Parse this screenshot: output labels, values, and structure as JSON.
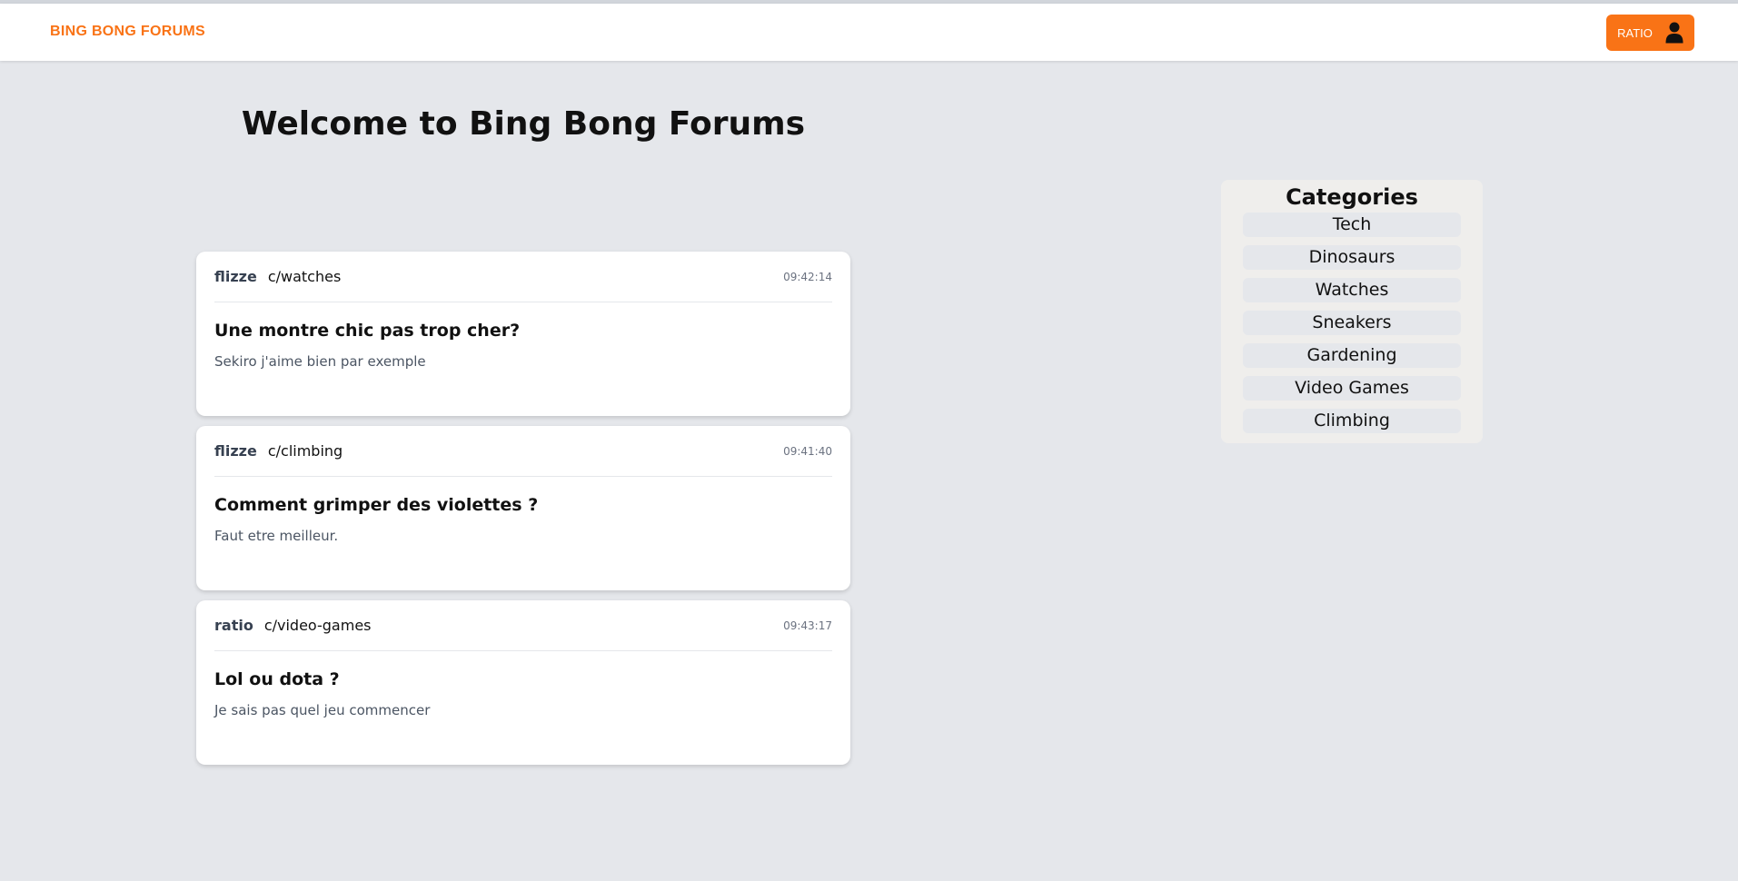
{
  "header": {
    "brand": "BING BONG FORUMS",
    "user_button_label": "RATIO",
    "user_icon": "user-icon"
  },
  "main": {
    "title": "Welcome to Bing Bong Forums",
    "posts": [
      {
        "author": "flizze",
        "category": "c/watches",
        "time": "09:42:14",
        "title": "Une montre chic pas trop cher?",
        "body": "Sekiro j'aime bien par exemple"
      },
      {
        "author": "flizze",
        "category": "c/climbing",
        "time": "09:41:40",
        "title": "Comment grimper des violettes ?",
        "body": "Faut etre meilleur."
      },
      {
        "author": "ratio",
        "category": "c/video-games",
        "time": "09:43:17",
        "title": "Lol ou dota ?",
        "body": "Je sais pas quel jeu commencer"
      }
    ]
  },
  "sidebar": {
    "title": "Categories",
    "items": [
      {
        "label": "Tech"
      },
      {
        "label": "Dinosaurs"
      },
      {
        "label": "Watches"
      },
      {
        "label": "Sneakers"
      },
      {
        "label": "Gardening"
      },
      {
        "label": "Video Games"
      },
      {
        "label": "Climbing"
      }
    ]
  },
  "colors": {
    "accent": "#f97316",
    "background": "#e5e7eb",
    "card": "#ffffff"
  }
}
